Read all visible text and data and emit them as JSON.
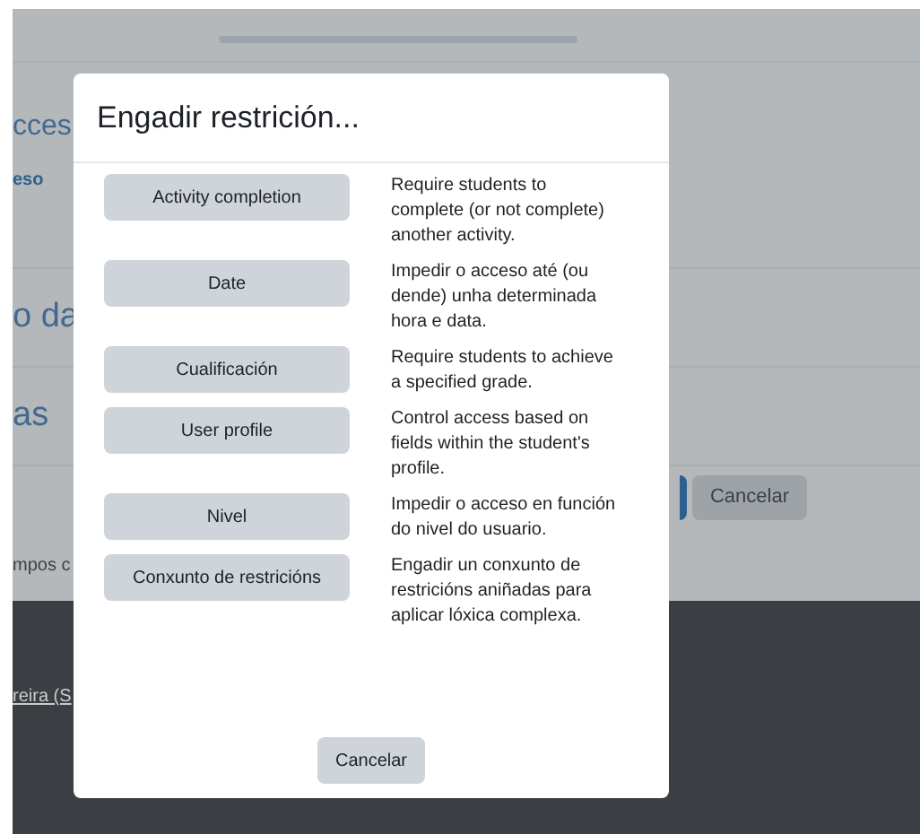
{
  "background": {
    "headings": [
      "cces",
      "o da",
      "as"
    ],
    "link": "eso",
    "cancel_button": "Cancelar",
    "note": "mpos c",
    "footer_link": "reira (S"
  },
  "dialog": {
    "title": "Engadir restrición...",
    "options": [
      {
        "button": "Activity completion",
        "description": "Require students to complete (or not complete) another activity."
      },
      {
        "button": "Date",
        "description": "Impedir o acceso até (ou dende) unha determinada hora e data."
      },
      {
        "button": "Cualificación",
        "description": "Require students to achieve a specified grade."
      },
      {
        "button": "User profile",
        "description": "Control access based on fields within the student's profile."
      },
      {
        "button": "Nivel",
        "description": "Impedir o acceso en función do nivel do usuario."
      },
      {
        "button": "Conxunto de restricións",
        "description": "Engadir un conxunto de restricións aniñadas para aplicar lóxica complexa."
      }
    ],
    "cancel_button": "Cancelar"
  }
}
